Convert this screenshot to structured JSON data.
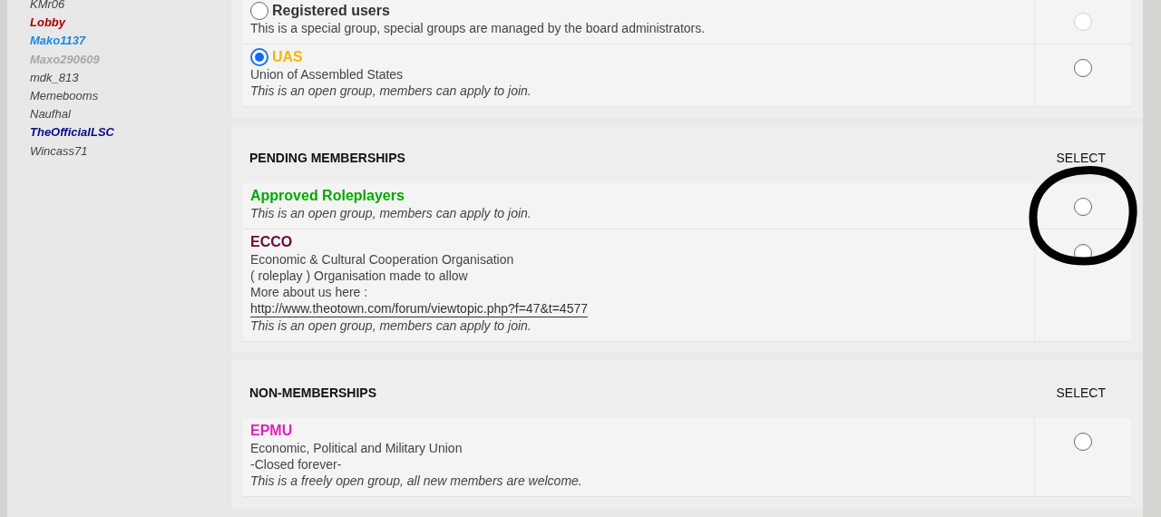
{
  "sidebar": {
    "users": [
      {
        "name": "KMr06",
        "color": "#444444",
        "kind": "plain"
      },
      {
        "name": "Lobby",
        "color": "#aa0000",
        "kind": "group"
      },
      {
        "name": "Mako1137",
        "color": "#1e88e5",
        "kind": "group"
      },
      {
        "name": "Maxo290609",
        "color": "#a8a8a8",
        "kind": "group"
      },
      {
        "name": "mdk_813",
        "color": "#444444",
        "kind": "plain"
      },
      {
        "name": "Memebooms",
        "color": "#444444",
        "kind": "plain"
      },
      {
        "name": "Naufhal",
        "color": "#444444",
        "kind": "plain"
      },
      {
        "name": "TheOfficialLSC",
        "color": "#0a0a8c",
        "kind": "group"
      },
      {
        "name": "Wincass71",
        "color": "#444444",
        "kind": "plain"
      }
    ]
  },
  "sections": [
    {
      "groups": [
        {
          "kind": "special",
          "name": "Registered users",
          "color": "#333333",
          "default_selected": false,
          "select_disabled": true,
          "note": "This is a special group, special groups are managed by the board administrators."
        },
        {
          "kind": "member",
          "name": "UAS",
          "color": "#f2b705",
          "default_selected": true,
          "select_disabled": false,
          "lines": [
            "Union of Assembled States"
          ],
          "note": "This is an open group, members can apply to join."
        }
      ]
    },
    {
      "heading": "PENDING MEMBERSHIPS",
      "select_label": "SELECT",
      "annotated": true,
      "groups": [
        {
          "kind": "listed",
          "name": "Approved Roleplayers",
          "color": "#00aa00",
          "select_disabled": false,
          "note": "This is an open group, members can apply to join."
        },
        {
          "kind": "listed",
          "name": "ECCO",
          "color": "#6b0a3c",
          "select_disabled": false,
          "lines": [
            "Economic & Cultural Cooperation Organisation",
            "( roleplay ) Organisation made to allow",
            "More about us here :"
          ],
          "link": "http://www.theotown.com/forum/viewtopic.php?f=47&t=4577",
          "note": "This is an open group, members can apply to join."
        }
      ]
    },
    {
      "heading": "NON-MEMBERSHIPS",
      "select_label": "SELECT",
      "annotated": false,
      "groups": [
        {
          "kind": "listed",
          "name": "EPMU",
          "color": "#dd22bb",
          "select_disabled": false,
          "lines": [
            "Economic, Political and Military Union",
            "-Closed forever-"
          ],
          "note": "This is a freely open group, all new members are welcome."
        }
      ]
    }
  ]
}
